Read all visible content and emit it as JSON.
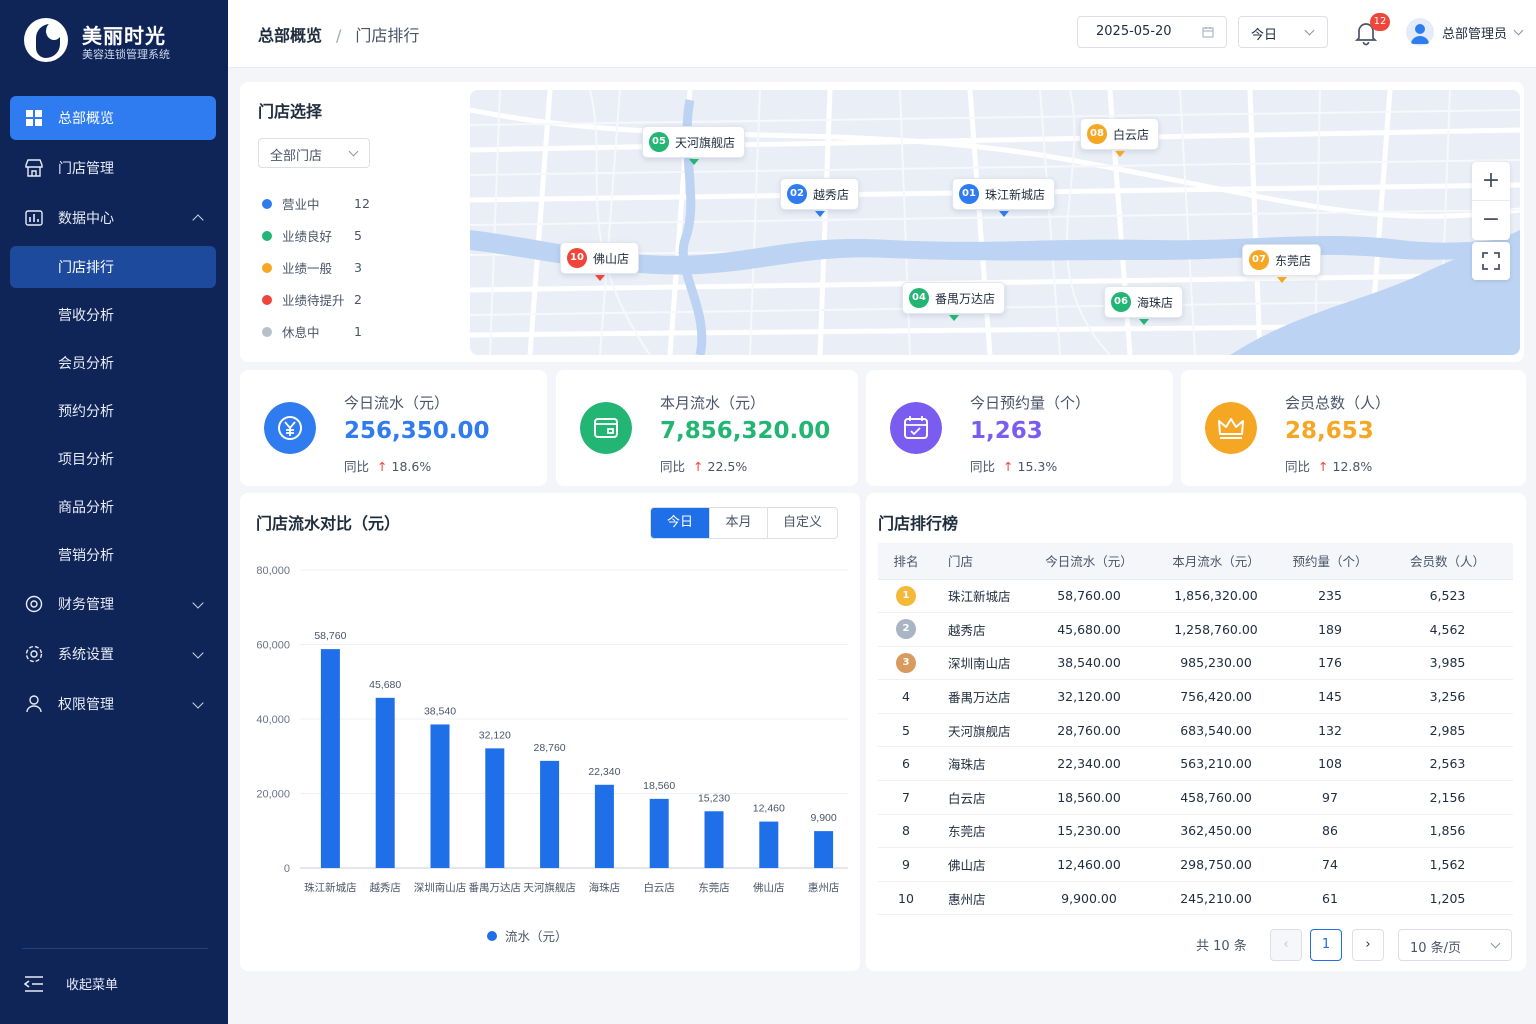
{
  "brand": {
    "title": "美丽时光",
    "subtitle": "美容连锁管理系统"
  },
  "sidebar": {
    "items": [
      {
        "label": "总部概览",
        "icon": "dashboard-icon",
        "active": true
      },
      {
        "label": "门店管理",
        "icon": "store-icon"
      },
      {
        "label": "数据中心",
        "icon": "data-center-icon",
        "expanded": true
      },
      {
        "label": "门店排行",
        "sub": true,
        "active": true
      },
      {
        "label": "营收分析",
        "sub": true
      },
      {
        "label": "会员分析",
        "sub": true
      },
      {
        "label": "预约分析",
        "sub": true
      },
      {
        "label": "项目分析",
        "sub": true
      },
      {
        "label": "商品分析",
        "sub": true
      },
      {
        "label": "营销分析",
        "sub": true
      },
      {
        "label": "财务管理",
        "icon": "finance-icon"
      },
      {
        "label": "系统设置",
        "icon": "settings-icon"
      },
      {
        "label": "权限管理",
        "icon": "permission-icon"
      }
    ],
    "collapse_label": "收起菜单"
  },
  "header": {
    "breadcrumb": [
      "总部概览",
      "门店排行"
    ],
    "date": "2025-05-20",
    "range": "今日",
    "notifications": "12",
    "user": "总部管理员"
  },
  "store_select": {
    "title": "门店选择",
    "dropdown": "全部门店",
    "legend": [
      {
        "label": "营业中",
        "count": "12",
        "color": "#2f7bf0"
      },
      {
        "label": "业绩良好",
        "count": "5",
        "color": "#22b573"
      },
      {
        "label": "业绩一般",
        "count": "3",
        "color": "#f5a623"
      },
      {
        "label": "业绩待提升",
        "count": "2",
        "color": "#f0453a"
      },
      {
        "label": "休息中",
        "count": "1",
        "color": "#b8c0cc"
      }
    ]
  },
  "map": {
    "pins": [
      {
        "num": "05",
        "name": "天河旗舰店",
        "color": "#22b573"
      },
      {
        "num": "08",
        "name": "白云店",
        "color": "#f5a623"
      },
      {
        "num": "02",
        "name": "越秀店",
        "color": "#2f7bf0"
      },
      {
        "num": "01",
        "name": "珠江新城店",
        "color": "#2f7bf0"
      },
      {
        "num": "10",
        "name": "佛山店",
        "color": "#f0453a"
      },
      {
        "num": "07",
        "name": "东莞店",
        "color": "#f5a623"
      },
      {
        "num": "04",
        "name": "番禺万达店",
        "color": "#22b573"
      },
      {
        "num": "06",
        "name": "海珠店",
        "color": "#22b573"
      }
    ],
    "zoom_in": "+",
    "zoom_out": "−"
  },
  "stats": [
    {
      "label": "今日流水（元）",
      "value": "256,350.00",
      "trend_label": "同比",
      "trend": "18.6%",
      "color": "#2f7bf0",
      "icon": "yuan-icon"
    },
    {
      "label": "本月流水（元）",
      "value": "7,856,320.00",
      "trend_label": "同比",
      "trend": "22.5%",
      "color": "#22b573",
      "icon": "wallet-icon"
    },
    {
      "label": "今日预约量（个）",
      "value": "1,263",
      "trend_label": "同比",
      "trend": "15.3%",
      "color": "#7b5cf0",
      "icon": "calendar-icon"
    },
    {
      "label": "会员总数（人）",
      "value": "28,653",
      "trend_label": "同比",
      "trend": "12.8%",
      "color": "#f5a623",
      "icon": "crown-icon"
    }
  ],
  "chart_card": {
    "title": "门店流水对比（元）",
    "tabs": [
      "今日",
      "本月",
      "自定义"
    ],
    "active_tab": "今日"
  },
  "chart_data": {
    "type": "bar",
    "title": "门店流水对比（元）",
    "categories": [
      "珠江新城店",
      "越秀店",
      "深圳南山店",
      "番禺万达店",
      "天河旗舰店",
      "海珠店",
      "白云店",
      "东莞店",
      "佛山店",
      "惠州店"
    ],
    "series": [
      {
        "name": "流水（元）",
        "values": [
          58760,
          45680,
          38540,
          32120,
          28760,
          22340,
          18560,
          15230,
          12460,
          9900
        ],
        "color": "#1f6fe8"
      }
    ],
    "value_labels": [
      "58,760",
      "45,680",
      "38,540",
      "32,120",
      "28,760",
      "22,340",
      "18,560",
      "15,230",
      "12,460",
      "9,900"
    ],
    "yticks": [
      "0",
      "20,000",
      "40,000",
      "60,000",
      "80,000"
    ],
    "ylim": [
      0,
      80000
    ],
    "grid": true,
    "legend_position": "bottom"
  },
  "ranking": {
    "title": "门店排行榜",
    "columns": [
      "排名",
      "门店",
      "今日流水（元）",
      "本月流水（元）",
      "预约量（个）",
      "会员数（人）"
    ],
    "rows": [
      [
        "1",
        "珠江新城店",
        "58,760.00",
        "1,856,320.00",
        "235",
        "6,523"
      ],
      [
        "2",
        "越秀店",
        "45,680.00",
        "1,258,760.00",
        "189",
        "4,562"
      ],
      [
        "3",
        "深圳南山店",
        "38,540.00",
        "985,230.00",
        "176",
        "3,985"
      ],
      [
        "4",
        "番禺万达店",
        "32,120.00",
        "756,420.00",
        "145",
        "3,256"
      ],
      [
        "5",
        "天河旗舰店",
        "28,760.00",
        "683,540.00",
        "132",
        "2,985"
      ],
      [
        "6",
        "海珠店",
        "22,340.00",
        "563,210.00",
        "108",
        "2,563"
      ],
      [
        "7",
        "白云店",
        "18,560.00",
        "458,760.00",
        "97",
        "2,156"
      ],
      [
        "8",
        "东莞店",
        "15,230.00",
        "362,450.00",
        "86",
        "1,856"
      ],
      [
        "9",
        "佛山店",
        "12,460.00",
        "298,750.00",
        "74",
        "1,562"
      ],
      [
        "10",
        "惠州店",
        "9,900.00",
        "245,210.00",
        "61",
        "1,205"
      ]
    ],
    "medal_colors": [
      "#f5b93a",
      "#a9b4c4",
      "#d99a5e"
    ],
    "total": "共 10 条",
    "page": "1",
    "page_size": "10 条/页",
    "prev": "‹",
    "next": "›"
  }
}
